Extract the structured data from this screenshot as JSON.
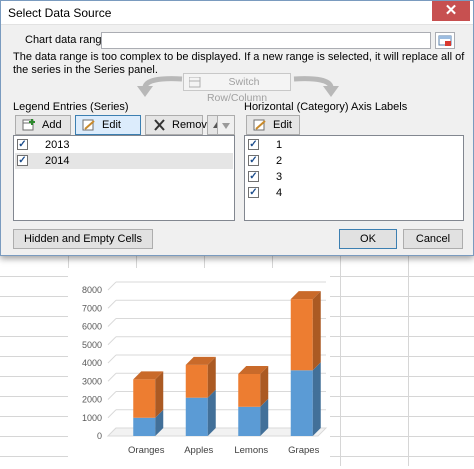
{
  "dialog": {
    "title": "Select Data Source",
    "close_label": "✕",
    "chart_range_label": "Chart data range:",
    "chart_range_value": "",
    "message": "The data range is too complex to be displayed. If a new range is selected, it will replace all of the series in the Series panel.",
    "switch_label": "Switch Row/Column",
    "legend_label": "Legend Entries (Series)",
    "axis_label": "Horizontal (Category) Axis Labels",
    "legend_buttons": {
      "add": "Add",
      "edit": "Edit",
      "remove": "Remove"
    },
    "axis_buttons": {
      "edit": "Edit"
    },
    "series": [
      {
        "name": "2013",
        "checked": true,
        "selected": false
      },
      {
        "name": "2014",
        "checked": true,
        "selected": true
      }
    ],
    "categories": [
      {
        "name": "1",
        "checked": true
      },
      {
        "name": "2",
        "checked": true
      },
      {
        "name": "3",
        "checked": true
      },
      {
        "name": "4",
        "checked": true
      }
    ],
    "hidden_cells_label": "Hidden and Empty Cells",
    "ok_label": "OK",
    "cancel_label": "Cancel"
  },
  "chart_data": {
    "type": "bar",
    "stacked": true,
    "style": "3d-column",
    "categories": [
      "Oranges",
      "Apples",
      "Lemons",
      "Grapes"
    ],
    "series": [
      {
        "values": [
          1000,
          2100,
          1600,
          3600
        ],
        "color": "#5b9bd5"
      },
      {
        "values": [
          2100,
          1800,
          1800,
          3900
        ],
        "color": "#ed7d31"
      }
    ],
    "ylim": [
      0,
      8000
    ],
    "yticks": [
      "0",
      "1000",
      "2000",
      "3000",
      "4000",
      "5000",
      "6000",
      "7000",
      "8000"
    ],
    "grid": true
  }
}
